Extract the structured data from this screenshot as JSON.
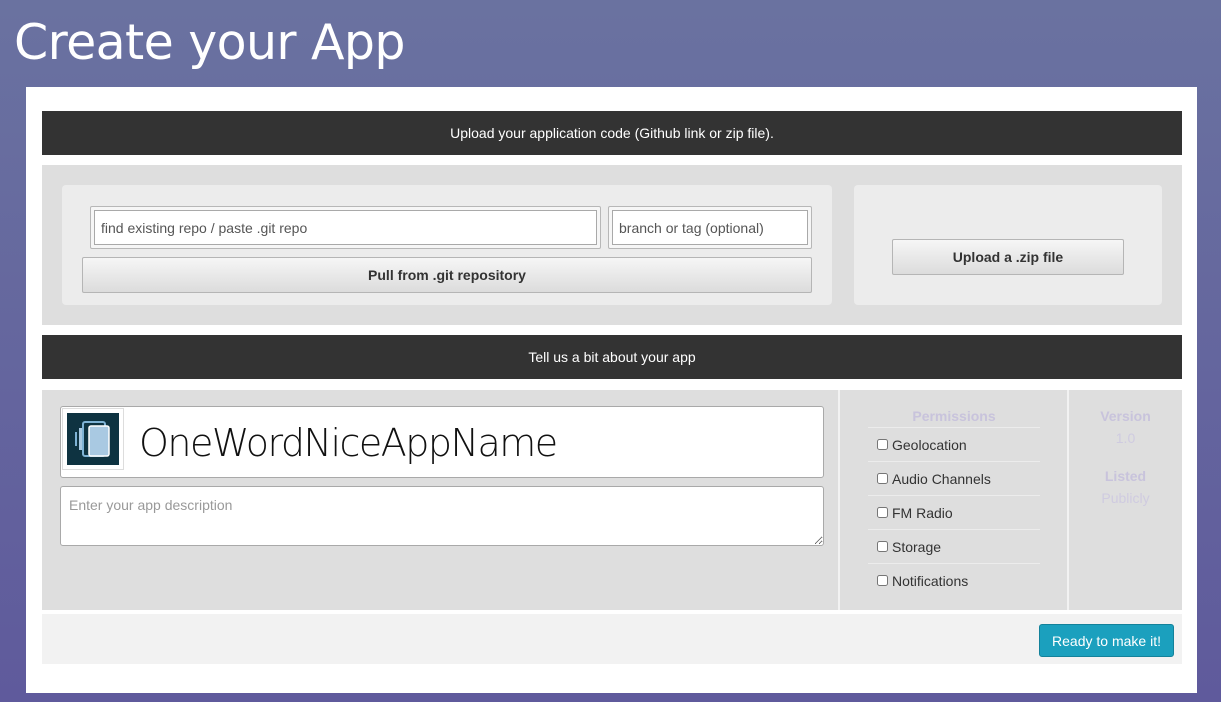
{
  "page": {
    "title": "Create your App"
  },
  "upload": {
    "header": "Upload your application code (Github link or zip file).",
    "repo_placeholder": "find existing repo / paste .git repo",
    "branch_placeholder": "branch or tag (optional)",
    "pull_label": "Pull from .git repository",
    "zip_label": "Upload a .zip file"
  },
  "about": {
    "header": "Tell us a bit about your app",
    "app_icon": "app-phones-icon",
    "app_name": "OneWordNiceAppName",
    "description_placeholder": "Enter your app description",
    "permissions_heading": "Permissions",
    "permissions": [
      {
        "label": "Geolocation",
        "checked": false
      },
      {
        "label": "Audio Channels",
        "checked": false
      },
      {
        "label": "FM Radio",
        "checked": false
      },
      {
        "label": "Storage",
        "checked": false
      },
      {
        "label": "Notifications",
        "checked": false
      }
    ],
    "version_label": "Version",
    "version_value": "1.0",
    "listed_label": "Listed",
    "listed_value": "Publicly"
  },
  "footer": {
    "ready_label": "Ready to make it!"
  },
  "colors": {
    "background": "#6a72a0",
    "header_bar": "#333333",
    "accent_button": "#1ba0be",
    "app_icon_bg": "#0e3341"
  }
}
